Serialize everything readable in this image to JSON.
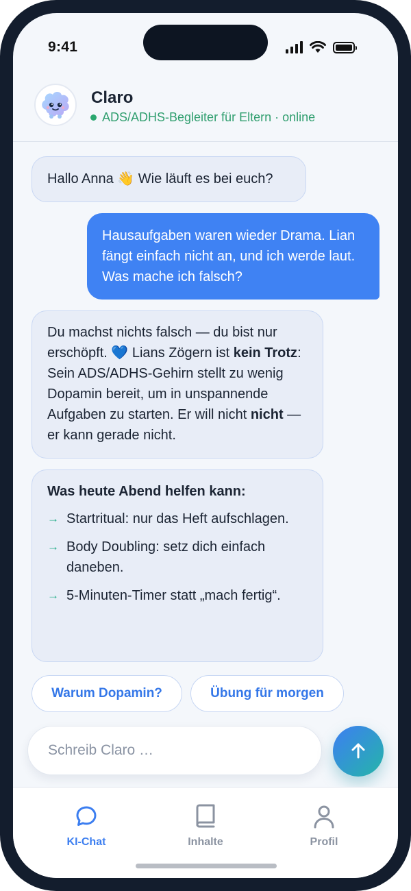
{
  "status_bar": {
    "time": "9:41",
    "icons": [
      "cellular-signal-icon",
      "wifi-icon",
      "battery-icon"
    ]
  },
  "header": {
    "avatar_icon": "brain-mascot-icon",
    "name": "Claro",
    "status": "ADS/ADHS-Begleiter für Eltern · online",
    "status_color": "#2f9e6e"
  },
  "messages": [
    {
      "from": "bot",
      "text": "Hallo Anna 👋 Wie läuft es bei euch?"
    },
    {
      "from": "user",
      "text": "Hausaufgaben waren wieder Drama. Lian fängt einfach nicht an, und ich werde laut. Was mache ich falsch?"
    },
    {
      "from": "bot",
      "parts": [
        "Du machst nichts falsch — du bist nur erschöpft. 💙 Lians Zögern ist ",
        "kein Trotz",
        ": Sein ADS/ADHS-Gehirn stellt zu wenig Dopamin bereit, um in unspannende Aufgaben zu starten. Er will nicht ",
        "nicht",
        " — er kann gerade nicht."
      ]
    },
    {
      "from": "bot",
      "title": "Was heute Abend helfen kann:",
      "arrow": "→",
      "items": [
        "Startritual: nur das Heft aufschlagen.",
        "Body Doubling: setz dich einfach daneben.",
        "5-Minuten-Timer statt „mach fertig“."
      ]
    }
  ],
  "suggestions": [
    "Warum Dopamin?",
    "Übung für morgen"
  ],
  "composer": {
    "placeholder": "Schreib Claro …",
    "send_icon": "arrow-up-icon"
  },
  "tabs": [
    {
      "label": "KI-Chat",
      "icon": "chat-bubble-icon",
      "active": true
    },
    {
      "label": "Inhalte",
      "icon": "book-icon",
      "active": false
    },
    {
      "label": "Profil",
      "icon": "user-icon",
      "active": false
    }
  ],
  "colors": {
    "accent_blue": "#3f82f3",
    "teal": "#25b5a9",
    "bot_bubble": "#e8edf7",
    "online_green": "#2aa76f"
  }
}
